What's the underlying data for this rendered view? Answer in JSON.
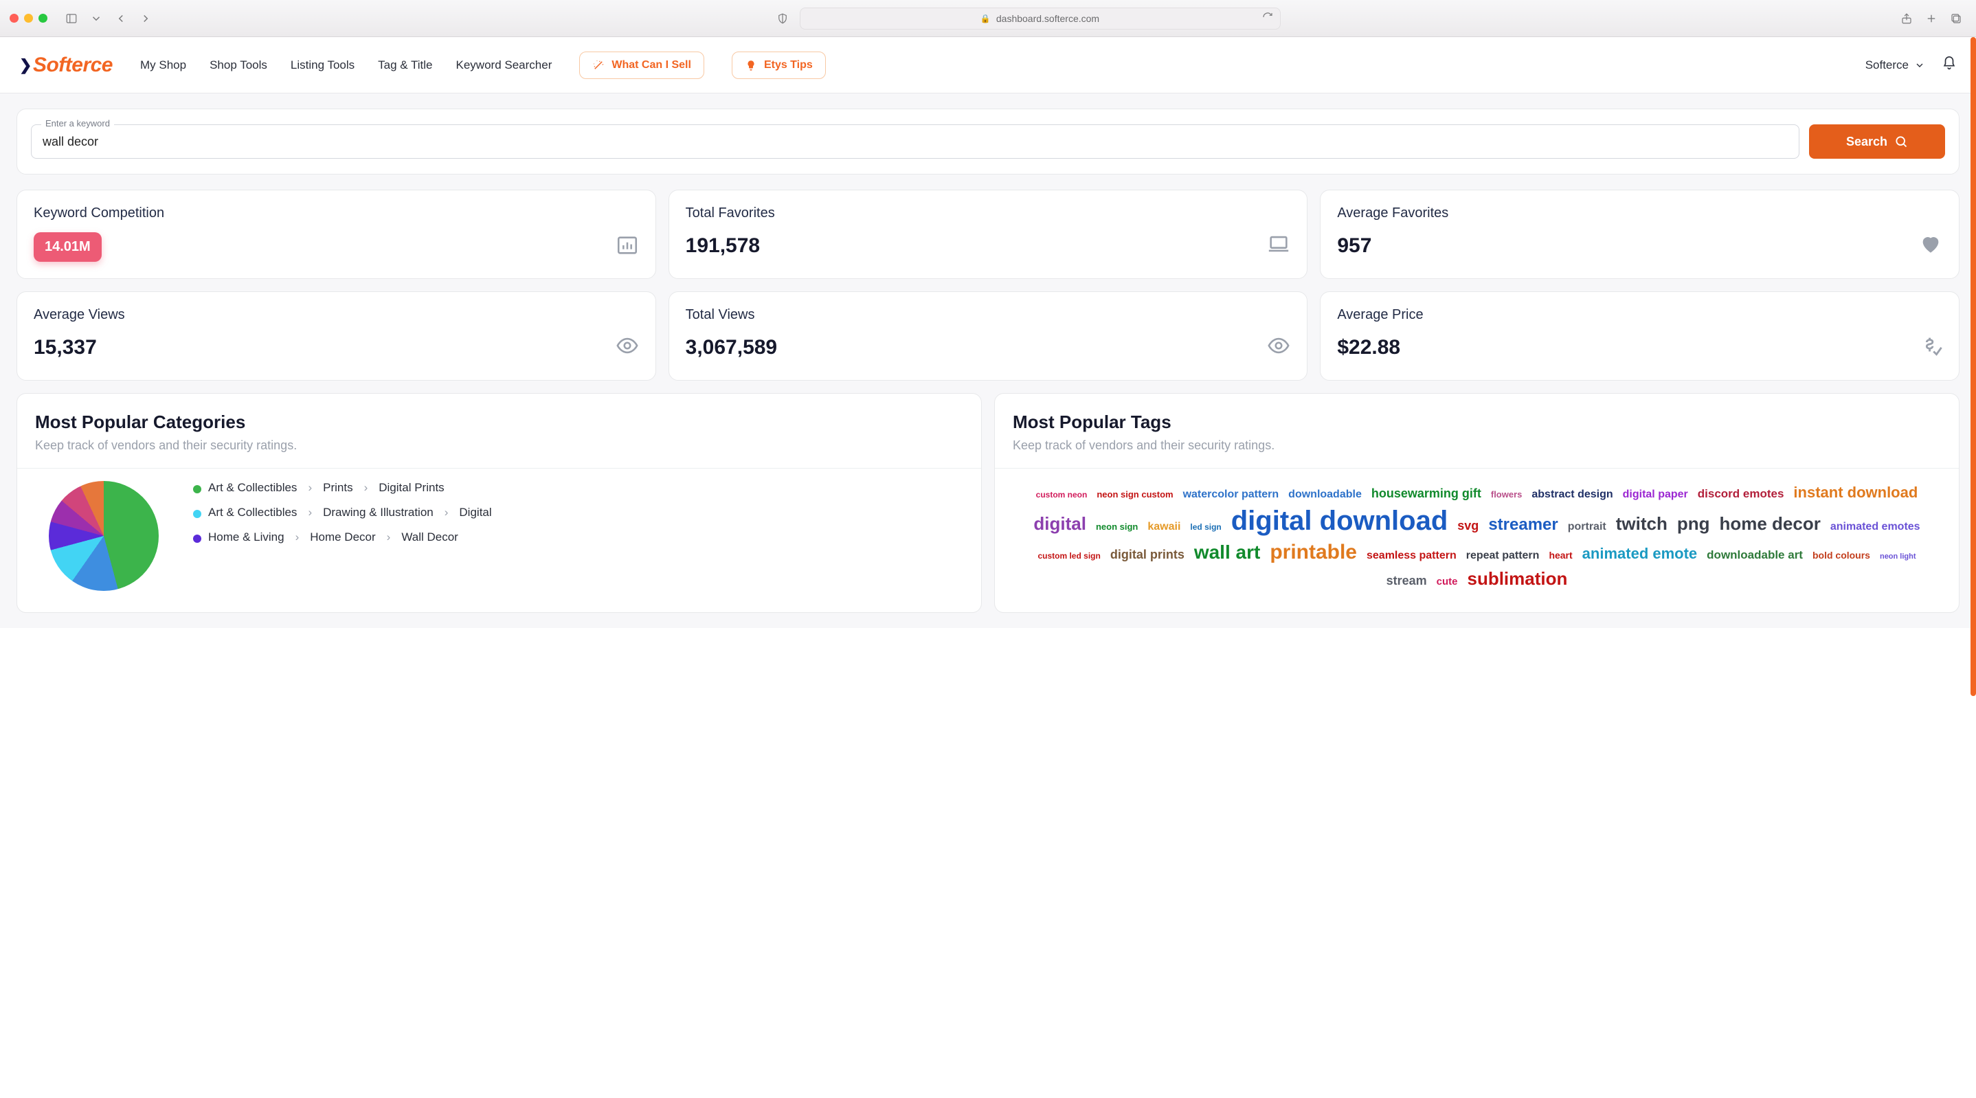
{
  "browser": {
    "url": "dashboard.softerce.com"
  },
  "app": {
    "brand": "Softerce",
    "nav": [
      "My Shop",
      "Shop Tools",
      "Listing Tools",
      "Tag & Title",
      "Keyword Searcher"
    ],
    "action_buttons": {
      "what_sell": "What Can I Sell",
      "tips": "Etys Tips"
    },
    "user_name": "Softerce"
  },
  "search": {
    "label": "Enter a keyword",
    "value": "wall decor",
    "button": "Search"
  },
  "stats": [
    {
      "title": "Keyword Competition",
      "value": "14.01M",
      "icon": "chart-bar",
      "badge": true
    },
    {
      "title": "Total Favorites",
      "value": "191,578",
      "icon": "laptop"
    },
    {
      "title": "Average Favorites",
      "value": "957",
      "icon": "heart"
    },
    {
      "title": "Average Views",
      "value": "15,337",
      "icon": "eye"
    },
    {
      "title": "Total Views",
      "value": "3,067,589",
      "icon": "eye"
    },
    {
      "title": "Average Price",
      "value": "$22.88",
      "icon": "dollar-check"
    }
  ],
  "categories_panel": {
    "title": "Most Popular Categories",
    "subtitle": "Keep track of vendors and their security ratings.",
    "legend": [
      {
        "color": "#3cb44b",
        "path": [
          "Art & Collectibles",
          "Prints",
          "Digital Prints"
        ]
      },
      {
        "color": "#42d4f4",
        "path": [
          "Art & Collectibles",
          "Drawing & Illustration",
          "Digital"
        ]
      },
      {
        "color": "#5b2bd9",
        "path": [
          "Home & Living",
          "Home Decor",
          "Wall Decor"
        ]
      }
    ]
  },
  "tags_panel": {
    "title": "Most Popular Tags",
    "subtitle": "Keep track of vendors and their security ratings.",
    "tags": [
      {
        "text": "custom neon",
        "size": 12,
        "color": "#d11b5b"
      },
      {
        "text": "neon sign custom",
        "size": 13,
        "color": "#c31414"
      },
      {
        "text": "watercolor pattern",
        "size": 16,
        "color": "#2e72c9"
      },
      {
        "text": "downloadable",
        "size": 16,
        "color": "#2e72c9"
      },
      {
        "text": "housewarming gift",
        "size": 18,
        "color": "#118a2c"
      },
      {
        "text": "flowers",
        "size": 13,
        "color": "#b94f8a"
      },
      {
        "text": "abstract design",
        "size": 16,
        "color": "#1f2f66"
      },
      {
        "text": "digital paper",
        "size": 16,
        "color": "#9b27d2"
      },
      {
        "text": "discord emotes",
        "size": 17,
        "color": "#b21f3a"
      },
      {
        "text": "instant download",
        "size": 22,
        "color": "#e07a1e"
      },
      {
        "text": "digital",
        "size": 26,
        "color": "#8c3fae"
      },
      {
        "text": "neon sign",
        "size": 13,
        "color": "#118a2c"
      },
      {
        "text": "kawaii",
        "size": 16,
        "color": "#e59a28"
      },
      {
        "text": "led sign",
        "size": 12,
        "color": "#1b6fb5"
      },
      {
        "text": "digital download",
        "size": 40,
        "color": "#1b5cc2"
      },
      {
        "text": "svg",
        "size": 18,
        "color": "#c31414"
      },
      {
        "text": "streamer",
        "size": 24,
        "color": "#1b5cc2"
      },
      {
        "text": "portrait",
        "size": 16,
        "color": "#5a5f6a"
      },
      {
        "text": "twitch",
        "size": 26,
        "color": "#3a3f4a"
      },
      {
        "text": "png",
        "size": 26,
        "color": "#3a3f4a"
      },
      {
        "text": "home decor",
        "size": 26,
        "color": "#3a3f4a"
      },
      {
        "text": "animated emotes",
        "size": 16,
        "color": "#6a52d6"
      },
      {
        "text": "custom led sign",
        "size": 12,
        "color": "#c31414"
      },
      {
        "text": "digital prints",
        "size": 18,
        "color": "#7a5a3a"
      },
      {
        "text": "wall art",
        "size": 28,
        "color": "#118a2c"
      },
      {
        "text": "printable",
        "size": 30,
        "color": "#e07a1e"
      },
      {
        "text": "seamless pattern",
        "size": 16,
        "color": "#c31414"
      },
      {
        "text": "repeat pattern",
        "size": 16,
        "color": "#3a3f4a"
      },
      {
        "text": "heart",
        "size": 14,
        "color": "#c31414"
      },
      {
        "text": "animated emote",
        "size": 22,
        "color": "#1b9ac2"
      },
      {
        "text": "downloadable art",
        "size": 17,
        "color": "#2f7a3a"
      },
      {
        "text": "bold colours",
        "size": 14,
        "color": "#c33f1e"
      },
      {
        "text": "neon light",
        "size": 11,
        "color": "#6a52d6"
      },
      {
        "text": "stream",
        "size": 18,
        "color": "#5a5f6a"
      },
      {
        "text": "cute",
        "size": 15,
        "color": "#d11b5b"
      },
      {
        "text": "sublimation",
        "size": 26,
        "color": "#c31414"
      }
    ]
  },
  "chart_data": {
    "type": "pie",
    "title": "Most Popular Categories",
    "series": [
      {
        "name": "Art & Collectibles › Prints › Digital Prints",
        "value": 42,
        "color": "#3cb44b"
      },
      {
        "name": "(green slice 2)",
        "value": 4,
        "color": "#3cb44b"
      },
      {
        "name": "(blue slice)",
        "value": 14,
        "color": "#3e8ee0"
      },
      {
        "name": "Art & Collectibles › Drawing & Illustration › Digital",
        "value": 11,
        "color": "#42d4f4"
      },
      {
        "name": "Home & Living › Home Decor › Wall Decor",
        "value": 8,
        "color": "#5b2bd9"
      },
      {
        "name": "(purple slice)",
        "value": 7,
        "color": "#9c2fad"
      },
      {
        "name": "(pink slice)",
        "value": 7,
        "color": "#d1457b"
      },
      {
        "name": "(orange slice)",
        "value": 7,
        "color": "#e6773b"
      }
    ],
    "note": "Values are approximate percentages estimated from the pie arc lengths; only three legend rows are visible in the crop."
  }
}
